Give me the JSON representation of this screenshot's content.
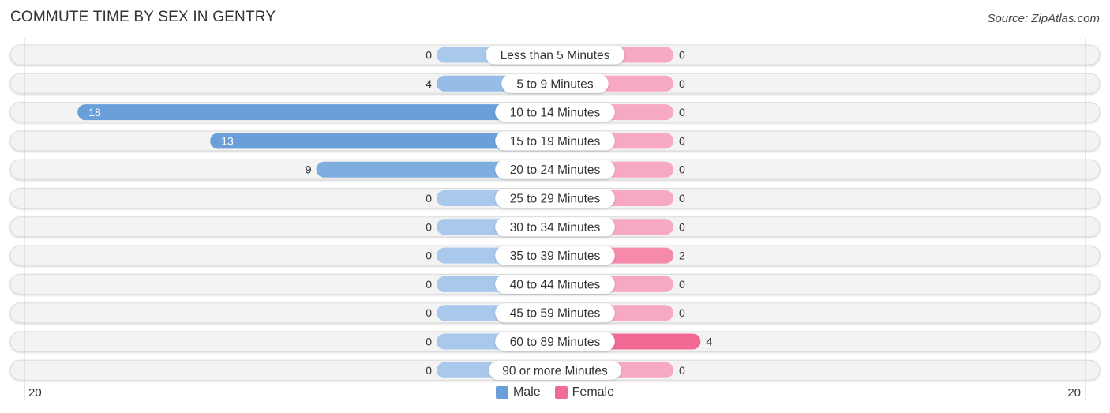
{
  "title": "COMMUTE TIME BY SEX IN GENTRY",
  "source": "Source: ZipAtlas.com",
  "colors": {
    "male_strong": "#6a9fd9",
    "male_light": "#a8c8ec",
    "female_strong": "#f06a94",
    "female_light": "#f7a8c2",
    "row_bg": "#f3f3f3"
  },
  "axis": {
    "left_label": "20",
    "right_label": "20"
  },
  "legend": [
    {
      "name": "Male",
      "color": "#6a9fd9"
    },
    {
      "name": "Female",
      "color": "#f06a94"
    }
  ],
  "chart_data": {
    "type": "bar",
    "orientation": "horizontal-diverging",
    "title": "COMMUTE TIME BY SEX IN GENTRY",
    "xlim": [
      -20,
      20
    ],
    "categories": [
      "Less than 5 Minutes",
      "5 to 9 Minutes",
      "10 to 14 Minutes",
      "15 to 19 Minutes",
      "20 to 24 Minutes",
      "25 to 29 Minutes",
      "30 to 34 Minutes",
      "35 to 39 Minutes",
      "40 to 44 Minutes",
      "45 to 59 Minutes",
      "60 to 89 Minutes",
      "90 or more Minutes"
    ],
    "series": [
      {
        "name": "Male",
        "values": [
          0,
          4,
          18,
          13,
          9,
          0,
          0,
          0,
          0,
          0,
          0,
          0
        ]
      },
      {
        "name": "Female",
        "values": [
          0,
          0,
          0,
          0,
          0,
          0,
          0,
          2,
          0,
          0,
          4,
          0
        ]
      }
    ],
    "legend_position": "bottom-center"
  }
}
